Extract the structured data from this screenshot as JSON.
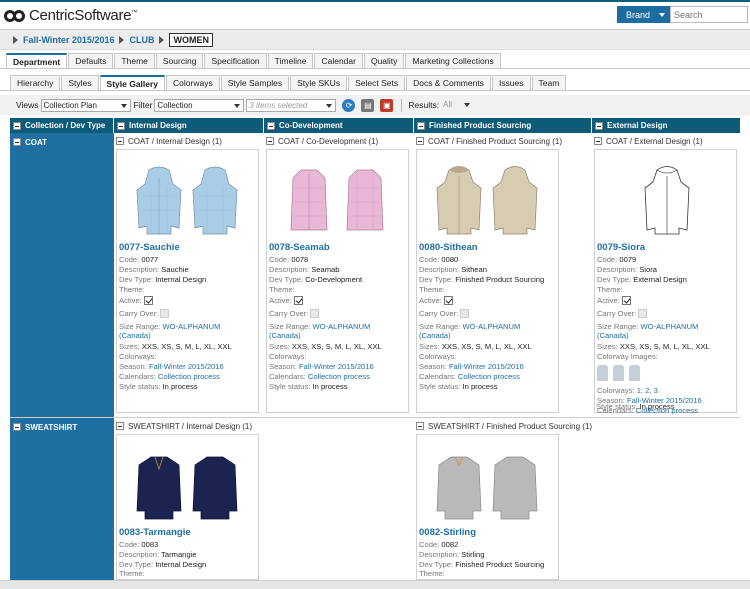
{
  "app": {
    "logo_name": "Centric",
    "logo_name2": "Software",
    "brand_button": "Brand",
    "search_placeholder": "Search"
  },
  "breadcrumb": [
    "Fall-Winter 2015/2016",
    "CLUB",
    "WOMEN"
  ],
  "tabs_main": [
    "Department",
    "Defaults",
    "Theme",
    "Sourcing",
    "Specification",
    "Timeline",
    "Calendar",
    "Quality",
    "Marketing Collections"
  ],
  "tabs_sub": [
    "Hierarchy",
    "Styles",
    "Style Gallery",
    "Colorways",
    "Style Samples",
    "Style SKUs",
    "Select Sets",
    "Docs & Comments",
    "Issues",
    "Team"
  ],
  "toolbar": {
    "views_label": "Views",
    "views_value": "Collection Plan",
    "filter_label": "Filter",
    "filter_value": "Collection",
    "items_placeholder": "3 items selected",
    "results_label": "Results:",
    "results_value": "All"
  },
  "grid": {
    "corner_header": "Collection / Dev Type",
    "columns": [
      "Internal Design",
      "Co-Development",
      "Finished Product Sourcing",
      "External Design"
    ],
    "rows": [
      "COAT",
      "SWEATSHIRT"
    ]
  },
  "labels": {
    "code": "Code:",
    "description": "Description:",
    "dev_type": "Dev Type:",
    "theme": "Theme:",
    "active": "Active:",
    "carry_over": "Carry Over:",
    "size_range": "Size Range:",
    "sizes": "Sizes:",
    "colorways": "Colorways:",
    "colorway_images": "Colorway Images:",
    "season": "Season:",
    "calendars": "Calendars:",
    "style_status": "Style status:"
  },
  "groups": {
    "coat_internal": "COAT / Internal Design (1)",
    "coat_codev": "COAT / Co-Development (1)",
    "coat_fps": "COAT / Finished Product Sourcing (1)",
    "coat_ext": "COAT / External Design (1)",
    "sweat_internal": "SWEATSHIRT / Internal Design (1)",
    "sweat_fps": "SWEATSHIRT / Finished Product Sourcing (1)"
  },
  "cards": {
    "c1": {
      "title": "0077-Sauchie",
      "code": "0077",
      "description": "Sauchie",
      "dev_type": "Internal Design",
      "size_range_a": "WO-ALPHANUM",
      "size_range_b": "(Canada)",
      "sizes": "XXS, XS, S, M, L, XL, XXL",
      "season": "Fall-Winter 2015/2016",
      "calendars": "Collection process",
      "status": "In process",
      "color": "#a9cde6"
    },
    "c2": {
      "title": "0078-Seamab",
      "code": "0078",
      "description": "Seamab",
      "dev_type": "Co-Development",
      "size_range_a": "WO-ALPHANUM",
      "size_range_b": "(Canada)",
      "sizes": "XXS, XS, S, M, L, XL, XXL",
      "season": "Fall-Winter 2015/2016",
      "calendars": "Collection process",
      "status": "In process",
      "color": "#eab8d6"
    },
    "c3": {
      "title": "0080-Sithean",
      "code": "0080",
      "description": "Sithean",
      "dev_type": "Finished Product Sourcing",
      "size_range_a": "WO-ALPHANUM",
      "size_range_b": "(Canada)",
      "sizes": "XXS, XS, S, M, L, XL, XXL",
      "season": "Fall-Winter 2015/2016",
      "calendars": "Collection process",
      "status": "In process",
      "color": "#d6ccb2"
    },
    "c4": {
      "title": "0079-Siora",
      "code": "0079",
      "description": "Siora",
      "dev_type": "External Design",
      "size_range_a": "WO-ALPHANUM",
      "size_range_b": "(Canada)",
      "sizes": "XXS, XS, S, M, L, XL, XXL",
      "colorways_list": [
        "1",
        "2",
        "3"
      ],
      "season": "Fall-Winter 2015/2016",
      "calendars": "Collection process",
      "status": "In process",
      "color": "#ffffff"
    },
    "c5": {
      "title": "0083-Tarmangie",
      "code": "0083",
      "description": "Tarmangie",
      "dev_type": "Internal Design",
      "color": "#1b2450"
    },
    "c6": {
      "title": "0082-Stirling",
      "code": "0082",
      "description": "Stirling",
      "dev_type": "Finished Product Sourcing",
      "color": "#b9b9bb"
    }
  }
}
